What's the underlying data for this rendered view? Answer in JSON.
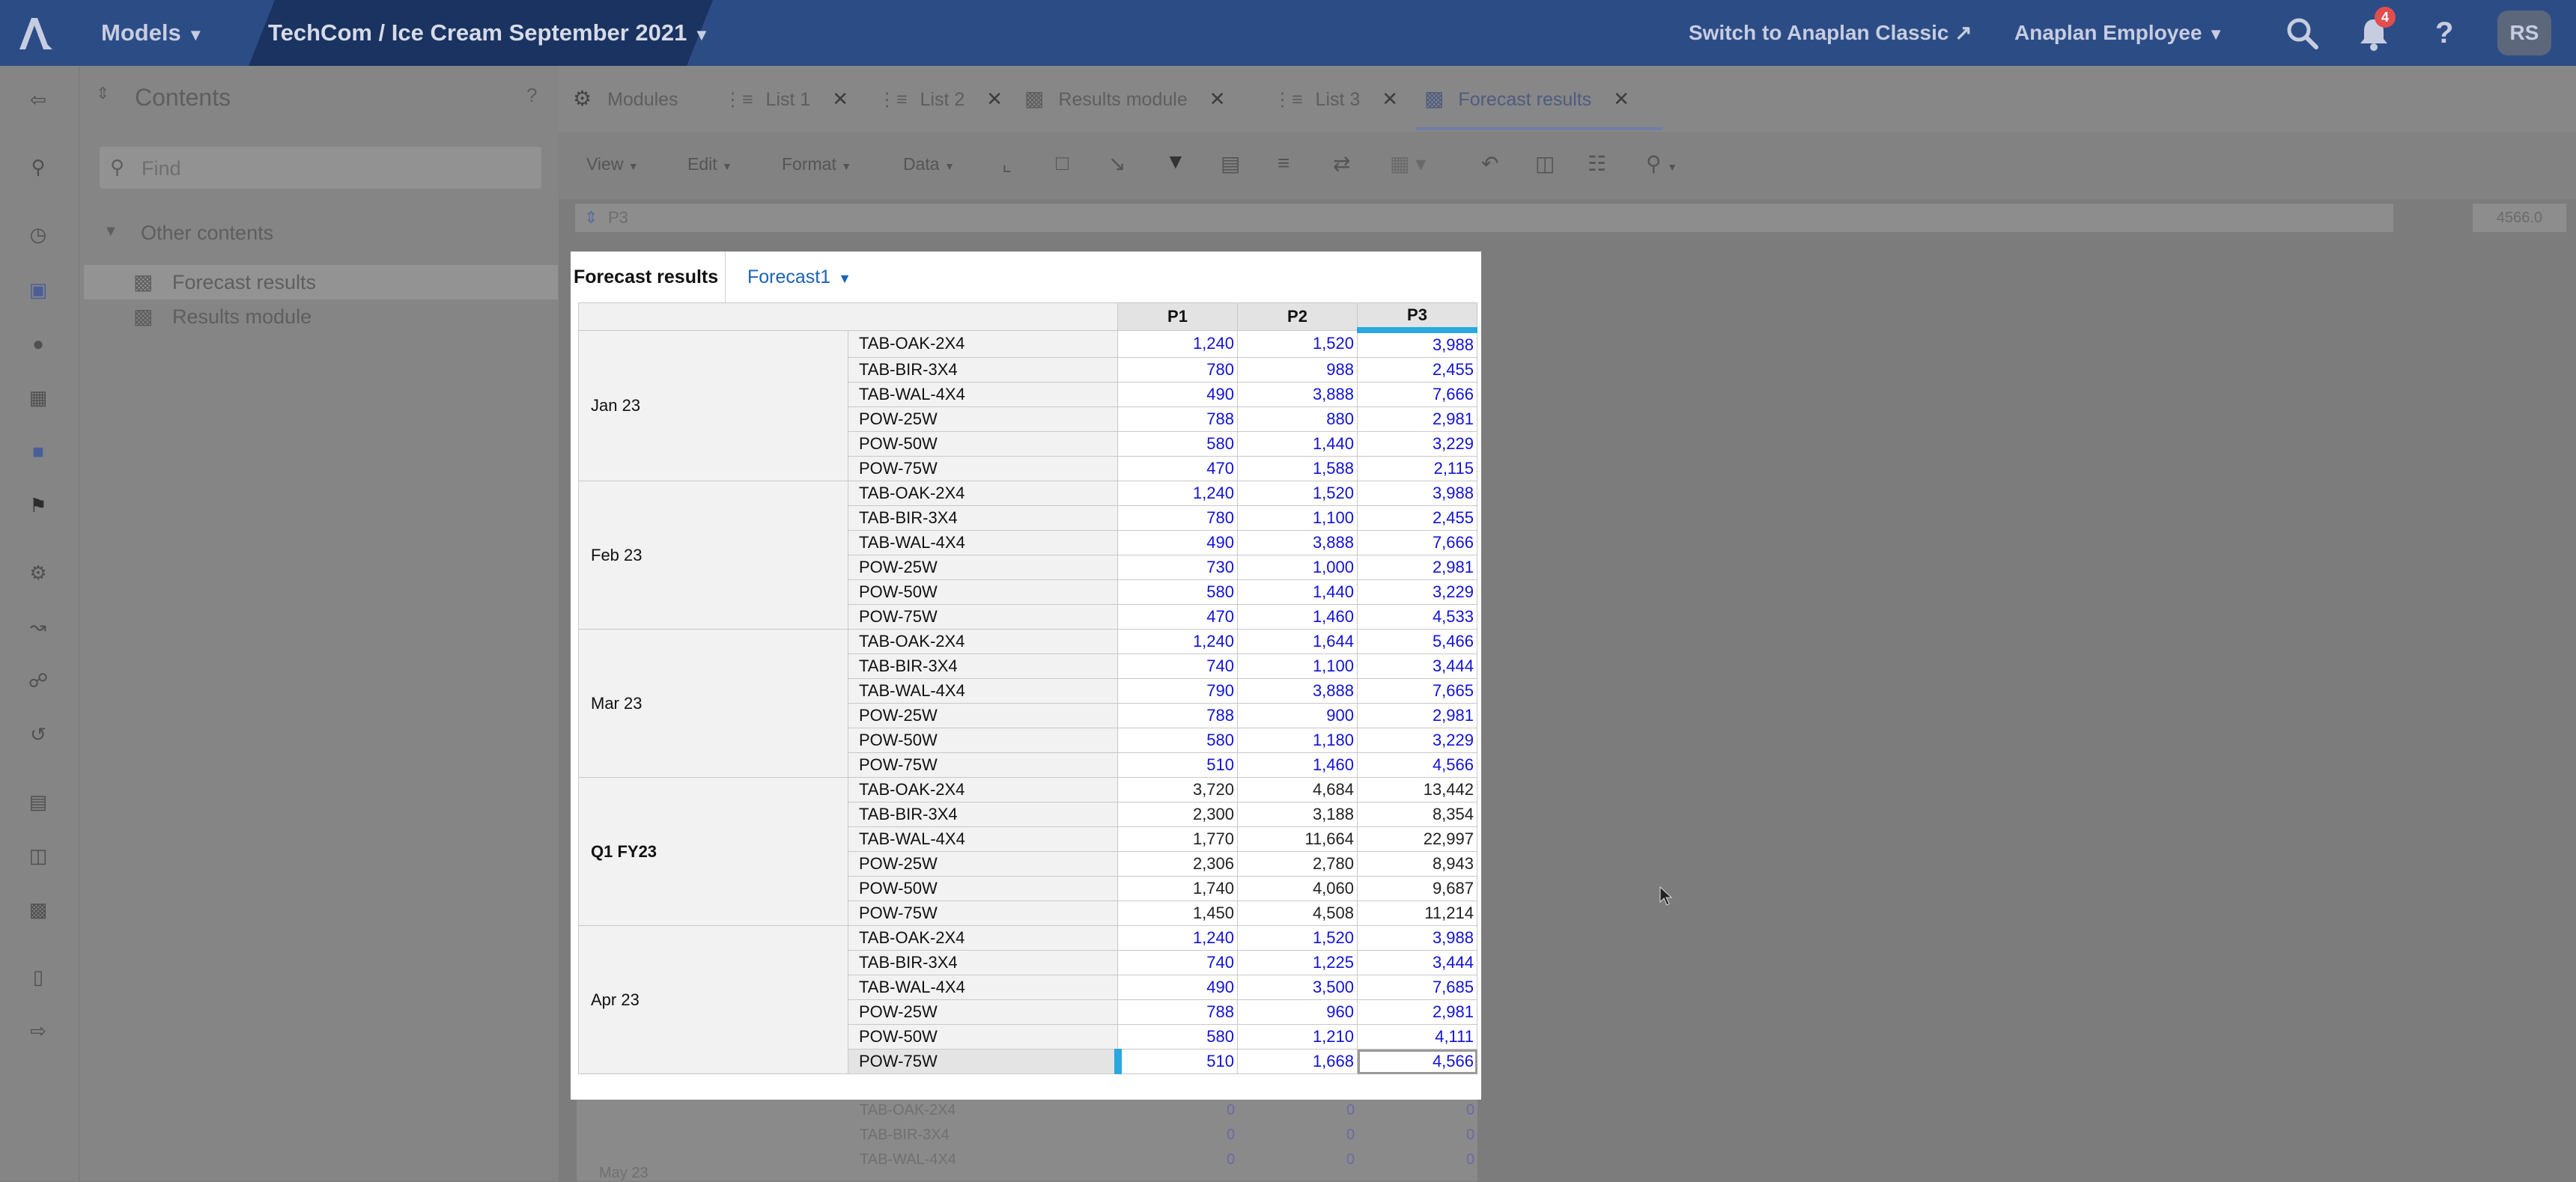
{
  "topbar": {
    "models_label": "Models",
    "workspace_label": "TechCom / Ice Cream September 2021",
    "switch_classic": "Switch to Anaplan Classic",
    "user_menu": "Anaplan Employee",
    "notification_count": "4",
    "avatar_initials": "RS"
  },
  "contents": {
    "title": "Contents",
    "help": "?",
    "find_placeholder": "Find",
    "group_label": "Other contents",
    "items": [
      {
        "label": "Forecast results"
      },
      {
        "label": "Results module"
      }
    ]
  },
  "tabs": [
    {
      "label": "Modules"
    },
    {
      "label": "List 1"
    },
    {
      "label": "List 2"
    },
    {
      "label": "Results module"
    },
    {
      "label": "List 3"
    },
    {
      "label": "Forecast results"
    }
  ],
  "toolbar": {
    "view": "View",
    "edit": "Edit",
    "format": "Format",
    "data": "Data"
  },
  "formula_bar": {
    "cell_ref": "P3",
    "right_value": "4566.0"
  },
  "grid": {
    "title": "Forecast results",
    "page_selector": "Forecast1",
    "columns": [
      "P1",
      "P2",
      "P3"
    ],
    "selected_column": "P3",
    "selected_cell": {
      "period": "Apr 23",
      "product": "POW-75W",
      "column": "P3"
    },
    "periods": [
      {
        "label": "Jan 23",
        "bold": false,
        "editable": true,
        "rows": [
          {
            "product": "TAB-OAK-2X4",
            "values": [
              "1,240",
              "1,520",
              "3,988"
            ]
          },
          {
            "product": "TAB-BIR-3X4",
            "values": [
              "780",
              "988",
              "2,455"
            ]
          },
          {
            "product": "TAB-WAL-4X4",
            "values": [
              "490",
              "3,888",
              "7,666"
            ]
          },
          {
            "product": "POW-25W",
            "values": [
              "788",
              "880",
              "2,981"
            ]
          },
          {
            "product": "POW-50W",
            "values": [
              "580",
              "1,440",
              "3,229"
            ]
          },
          {
            "product": "POW-75W",
            "values": [
              "470",
              "1,588",
              "2,115"
            ]
          }
        ]
      },
      {
        "label": "Feb 23",
        "bold": false,
        "editable": true,
        "rows": [
          {
            "product": "TAB-OAK-2X4",
            "values": [
              "1,240",
              "1,520",
              "3,988"
            ]
          },
          {
            "product": "TAB-BIR-3X4",
            "values": [
              "780",
              "1,100",
              "2,455"
            ]
          },
          {
            "product": "TAB-WAL-4X4",
            "values": [
              "490",
              "3,888",
              "7,666"
            ]
          },
          {
            "product": "POW-25W",
            "values": [
              "730",
              "1,000",
              "2,981"
            ]
          },
          {
            "product": "POW-50W",
            "values": [
              "580",
              "1,440",
              "3,229"
            ]
          },
          {
            "product": "POW-75W",
            "values": [
              "470",
              "1,460",
              "4,533"
            ]
          }
        ]
      },
      {
        "label": "Mar 23",
        "bold": false,
        "editable": true,
        "rows": [
          {
            "product": "TAB-OAK-2X4",
            "values": [
              "1,240",
              "1,644",
              "5,466"
            ]
          },
          {
            "product": "TAB-BIR-3X4",
            "values": [
              "740",
              "1,100",
              "3,444"
            ]
          },
          {
            "product": "TAB-WAL-4X4",
            "values": [
              "790",
              "3,888",
              "7,665"
            ]
          },
          {
            "product": "POW-25W",
            "values": [
              "788",
              "900",
              "2,981"
            ]
          },
          {
            "product": "POW-50W",
            "values": [
              "580",
              "1,180",
              "3,229"
            ]
          },
          {
            "product": "POW-75W",
            "values": [
              "510",
              "1,460",
              "4,566"
            ]
          }
        ]
      },
      {
        "label": "Q1 FY23",
        "bold": true,
        "editable": false,
        "rows": [
          {
            "product": "TAB-OAK-2X4",
            "values": [
              "3,720",
              "4,684",
              "13,442"
            ]
          },
          {
            "product": "TAB-BIR-3X4",
            "values": [
              "2,300",
              "3,188",
              "8,354"
            ]
          },
          {
            "product": "TAB-WAL-4X4",
            "values": [
              "1,770",
              "11,664",
              "22,997"
            ]
          },
          {
            "product": "POW-25W",
            "values": [
              "2,306",
              "2,780",
              "8,943"
            ]
          },
          {
            "product": "POW-50W",
            "values": [
              "1,740",
              "4,060",
              "9,687"
            ]
          },
          {
            "product": "POW-75W",
            "values": [
              "1,450",
              "4,508",
              "11,214"
            ]
          }
        ]
      },
      {
        "label": "Apr 23",
        "bold": false,
        "editable": true,
        "rows": [
          {
            "product": "TAB-OAK-2X4",
            "values": [
              "1,240",
              "1,520",
              "3,988"
            ]
          },
          {
            "product": "TAB-BIR-3X4",
            "values": [
              "740",
              "1,225",
              "3,444"
            ]
          },
          {
            "product": "TAB-WAL-4X4",
            "values": [
              "490",
              "3,500",
              "7,685"
            ]
          },
          {
            "product": "POW-25W",
            "values": [
              "788",
              "960",
              "2,981"
            ]
          },
          {
            "product": "POW-50W",
            "values": [
              "580",
              "1,210",
              "4,111"
            ]
          },
          {
            "product": "POW-75W",
            "values": [
              "510",
              "1,668",
              "4,566"
            ]
          }
        ]
      }
    ]
  },
  "below_card": {
    "next_period": "May 23",
    "rows": [
      {
        "product": "TAB-OAK-2X4",
        "values": [
          "0",
          "0",
          "0"
        ]
      },
      {
        "product": "TAB-BIR-3X4",
        "values": [
          "0",
          "0",
          "0"
        ]
      },
      {
        "product": "TAB-WAL-4X4",
        "values": [
          "0",
          "0",
          "0"
        ]
      }
    ]
  },
  "colors": {
    "topbar": "#2c4c86",
    "input_blue": "#1212d8",
    "selection_accent": "#27a8e0",
    "page_selector_link": "#1d62b7"
  }
}
